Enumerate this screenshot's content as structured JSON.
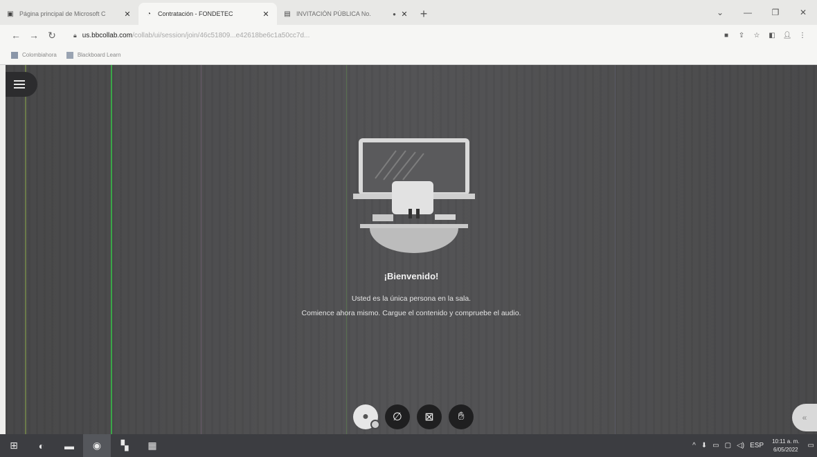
{
  "browser": {
    "tabs": [
      {
        "title": "Página principal de Microsoft C",
        "icon": "office-icon",
        "active": false
      },
      {
        "title": "Contratación - FONDETEC",
        "icon": "fondetec-icon",
        "active": true
      },
      {
        "title": "INVITACIÓN PÚBLICA No.",
        "icon": "document-icon",
        "active": false
      }
    ],
    "new_tab_glyph": "+",
    "url_domain": "us.bbcollab.com",
    "url_path": "/collab/ui/session/join/46c51809...e42618be6c1a50cc7d...",
    "bookmarks": [
      "Colombiahora",
      "Blackboard Learn"
    ]
  },
  "session": {
    "welcome_title": "¡Bienvenido!",
    "line1": "Usted es la única persona en la sala.",
    "line2": "Comience ahora mismo. Cargue el contenido y compruebe el audio."
  },
  "taskbar": {
    "language": "ESP",
    "time": "10:11 a. m.",
    "date": "6/05/2022"
  },
  "colors": {
    "session_bg": "#4a4a4b",
    "control_bg": "#1f1f20",
    "taskbar_bg": "#3c3d41"
  }
}
